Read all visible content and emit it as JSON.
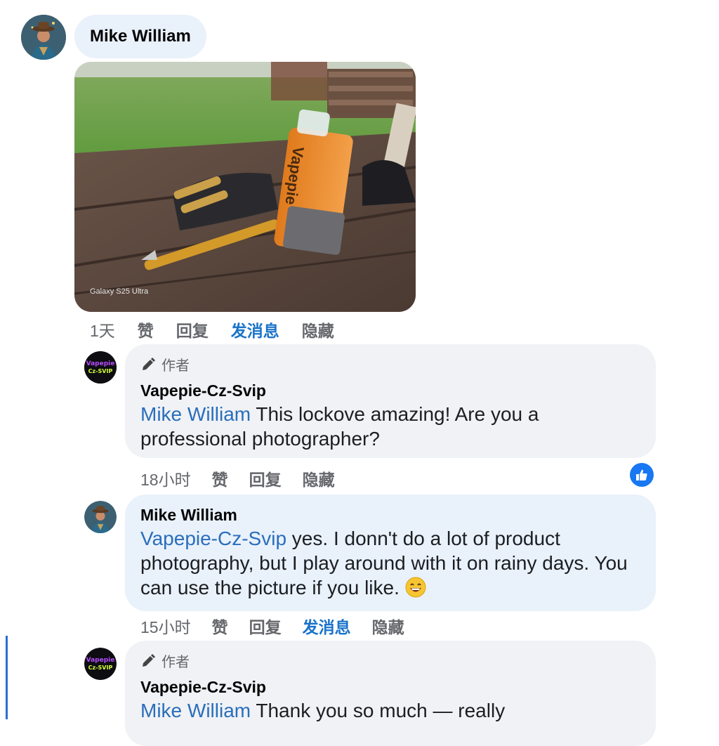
{
  "post": {
    "author_name": "Mike William",
    "photo_watermark": "Galaxy S25 Ultra",
    "product_label": "Vapepie",
    "time": "1天",
    "actions": {
      "like": "赞",
      "reply": "回复",
      "message": "发消息",
      "hide": "隐藏"
    }
  },
  "comments": [
    {
      "author_tag": "作者",
      "author": "Vapepie-Cz-Svip",
      "avatar_text": "Vapepie Cz-Svip",
      "mention": "Mike William",
      "text": " This lockove amazing! Are you a professional photographer?",
      "time": "18小时",
      "actions": {
        "like": "赞",
        "reply": "回复",
        "hide": "隐藏"
      },
      "has_like_reaction": true
    },
    {
      "author": "Mike William",
      "mention": "Vapepie-Cz-Svip",
      "text": " yes. I donn't do a lot of product photography, but I play around with it on rainy days. You can use the picture if you like. ",
      "emoji": "grinning-face",
      "time": "15小时",
      "actions": {
        "like": "赞",
        "reply": "回复",
        "message": "发消息",
        "hide": "隐藏"
      }
    },
    {
      "author_tag": "作者",
      "author": "Vapepie-Cz-Svip",
      "avatar_text": "Vapepie Cz-Svip",
      "mention": "Mike William",
      "text": " Thank you so much — really"
    }
  ],
  "colors": {
    "bubble_gray": "#f0f2f5",
    "bubble_blue": "#e9f1fb",
    "link_blue": "#1a73c9",
    "mention_blue": "#2a6ebb",
    "like_blue": "#1877f2"
  }
}
